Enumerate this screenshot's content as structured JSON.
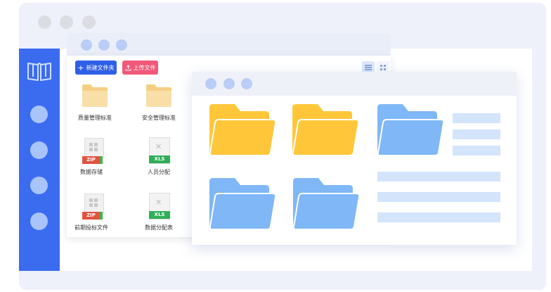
{
  "toolbar": {
    "new_folder_label": "新建文件夹",
    "upload_label": "上传文件"
  },
  "files": [
    {
      "name": "质量管理标准",
      "type": "folder"
    },
    {
      "name": "安全管理标准",
      "type": "folder"
    },
    {
      "name": "数据存储",
      "type": "zip",
      "badge": "ZIP"
    },
    {
      "name": "人员分配",
      "type": "xls",
      "badge": "XLS"
    },
    {
      "name": "前期投标文件",
      "type": "zip",
      "badge": "ZIP"
    },
    {
      "name": "数据分配表",
      "type": "xls",
      "badge": "XLS"
    }
  ],
  "colors": {
    "sidebar": "#3b6cf0",
    "folder_yellow": "#ffc63a",
    "folder_blue": "#7fb7f7",
    "zip_badge": "#e0543f",
    "xls_badge": "#2fae5a",
    "upload_button": "#f25878",
    "new_button": "#2f5fe6"
  },
  "icons": {
    "logo": "book-icon",
    "list_view": "list-view-icon",
    "grid_view": "grid-view-icon"
  }
}
